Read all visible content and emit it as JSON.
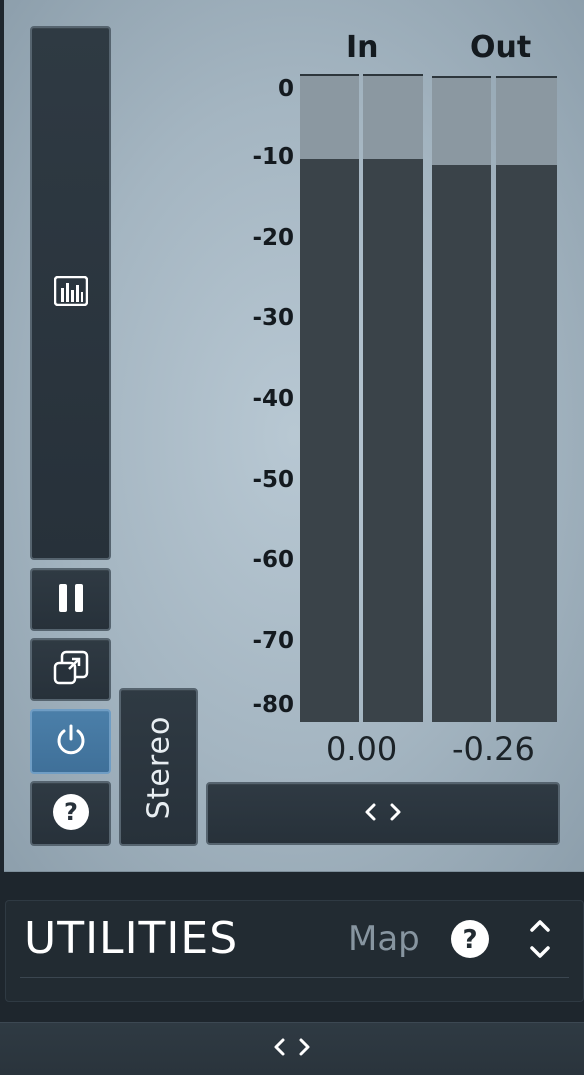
{
  "meter_panel": {
    "in_label": "In",
    "out_label": "Out",
    "scale_ticks": [
      "0",
      "-10",
      "-20",
      "-30",
      "-40",
      "-50",
      "-60",
      "-70",
      "-80"
    ],
    "in_readout": "0.00",
    "out_readout": "-0.26",
    "meter_levels_db": {
      "in_left": -10.5,
      "in_right": -10.5,
      "out_left": -11.0,
      "out_right": -11.0
    },
    "mode_button": "Stereo"
  },
  "utilities": {
    "title": "UTILITIES",
    "map_label": "Map"
  },
  "icons": {
    "meter_view": "bar-chart-icon",
    "pause": "pause-icon",
    "detach": "external-window-icon",
    "power": "power-icon",
    "help": "question-icon",
    "expand": "horizontal-expand-icon",
    "updown": "up-down-chevron-icon"
  },
  "colors": {
    "active_button": "#4b7fa9",
    "panel": "#a4b5c1",
    "dark": "#27313a"
  }
}
